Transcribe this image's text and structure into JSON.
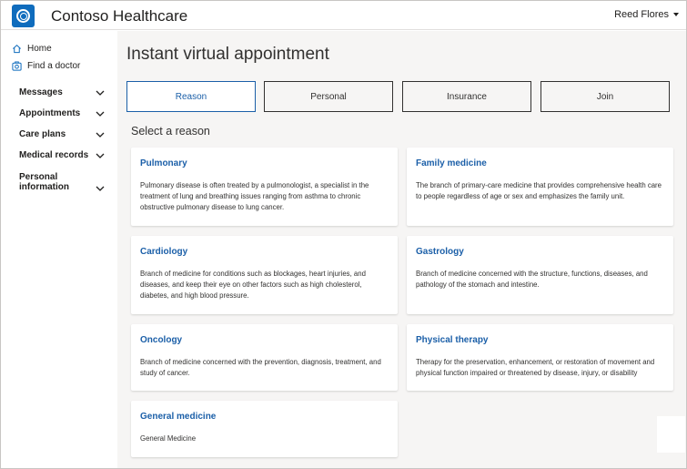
{
  "app": {
    "title": "Contoso Healthcare",
    "logo_icon": "contoso-ring-logo",
    "brand_color": "#0f6cbd"
  },
  "user": {
    "name": "Reed Flores",
    "menu_icon": "caret-down-icon"
  },
  "sidebar": {
    "links": [
      {
        "label": "Home",
        "icon": "home-icon"
      },
      {
        "label": "Find a doctor",
        "icon": "doctor-search-icon"
      }
    ],
    "groups": [
      {
        "label": "Messages"
      },
      {
        "label": "Appointments"
      },
      {
        "label": "Care plans"
      },
      {
        "label": "Medical records"
      },
      {
        "label": "Personal information"
      }
    ]
  },
  "main": {
    "title": "Instant virtual appointment",
    "steps": [
      {
        "label": "Reason",
        "active": true
      },
      {
        "label": "Personal",
        "active": false
      },
      {
        "label": "Insurance",
        "active": false
      },
      {
        "label": "Join",
        "active": false
      }
    ],
    "section_title": "Select a reason",
    "reasons": [
      {
        "title": "Pulmonary",
        "description": "Pulmonary disease is often treated by a pulmonologist, a specialist in the treatment of lung and breathing issues ranging from asthma to chronic obstructive pulmonary disease to lung cancer."
      },
      {
        "title": "Family medicine",
        "description": "The branch of primary-care medicine that provides comprehensive health care to people regardless of age or sex and emphasizes the family unit."
      },
      {
        "title": "Cardiology",
        "description": "Branch of medicine for conditions such as blockages, heart injuries, and diseases, and keep their eye on other factors such as high cholesterol, diabetes, and high blood pressure."
      },
      {
        "title": "Gastrology",
        "description": "Branch of medicine concerned with the structure, functions, diseases, and pathology of the stomach and intestine."
      },
      {
        "title": "Oncology",
        "description": "Branch of medicine concerned with the prevention, diagnosis, treatment, and study of cancer."
      },
      {
        "title": "Physical therapy",
        "description": "Therapy for the preservation, enhancement, or restoration of movement and physical function impaired or threatened by disease, injury, or disability"
      },
      {
        "title": "General medicine",
        "description": "General Medicine"
      }
    ]
  },
  "colors": {
    "accent": "#1b5fa8",
    "background": "#f6f5f4"
  }
}
